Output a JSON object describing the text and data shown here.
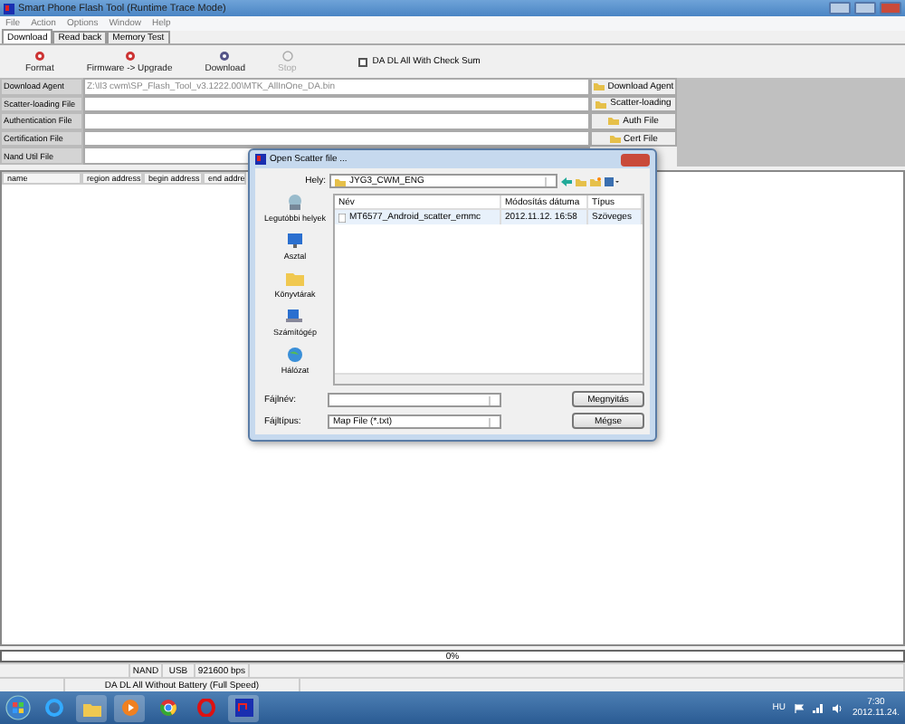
{
  "window": {
    "title": "Smart Phone Flash Tool (Runtime Trace Mode)"
  },
  "menu": [
    "File",
    "Action",
    "Options",
    "Window",
    "Help"
  ],
  "tabs": [
    {
      "label": "Download",
      "selected": true
    },
    {
      "label": "Read back",
      "selected": false
    },
    {
      "label": "Memory Test",
      "selected": false
    }
  ],
  "toolbar": [
    {
      "label": "Format",
      "disabled": false
    },
    {
      "label": "Firmware -> Upgrade",
      "disabled": false
    },
    {
      "label": "Download",
      "disabled": false
    },
    {
      "label": "Stop",
      "disabled": true
    }
  ],
  "checksum": {
    "label": "DA DL All With Check Sum",
    "checked": false
  },
  "files": [
    {
      "label": "Download Agent",
      "value": "Z:\\Il3 cwm\\SP_Flash_Tool_v3.1222.00\\MTK_AllInOne_DA.bin"
    },
    {
      "label": "Scatter-loading File"
    },
    {
      "label": "Authentication File"
    },
    {
      "label": "Certification File"
    },
    {
      "label": "Nand Util File"
    }
  ],
  "file_buttons": [
    "Download Agent",
    "Scatter-loading",
    "Auth File",
    "Cert File"
  ],
  "table": {
    "columns": [
      "name",
      "region address",
      "begin address",
      "end addre"
    ]
  },
  "progress": {
    "level": 0,
    "text": "0%"
  },
  "status": [
    "NAND",
    "USB",
    "921600 bps"
  ],
  "status_mode": "DA DL All Without Battery (Full Speed)",
  "dialog": {
    "title": "Open Scatter file ...",
    "look_in_label": "Hely:",
    "look_in": "JYG3_CWM_ENG",
    "places": [
      "Legutóbbi helyek",
      "Asztal",
      "Könyvtárak",
      "Számítógép",
      "Hálózat"
    ],
    "columns": [
      "Név",
      "Módosítás dátuma",
      "Típus"
    ],
    "files": [
      {
        "name": "MT6577_Android_scatter_emmc",
        "date": "2012.11.12. 16:58",
        "type": "Szöveges"
      }
    ],
    "filename_label": "Fájlnév:",
    "filetype_label": "Fájltípus:",
    "filetype": "Map File (*.txt)",
    "open": "Megnyitás",
    "cancel": "Mégse"
  },
  "taskbar": {
    "language": "HU",
    "time": "7:30",
    "date": "2012.11.24."
  }
}
